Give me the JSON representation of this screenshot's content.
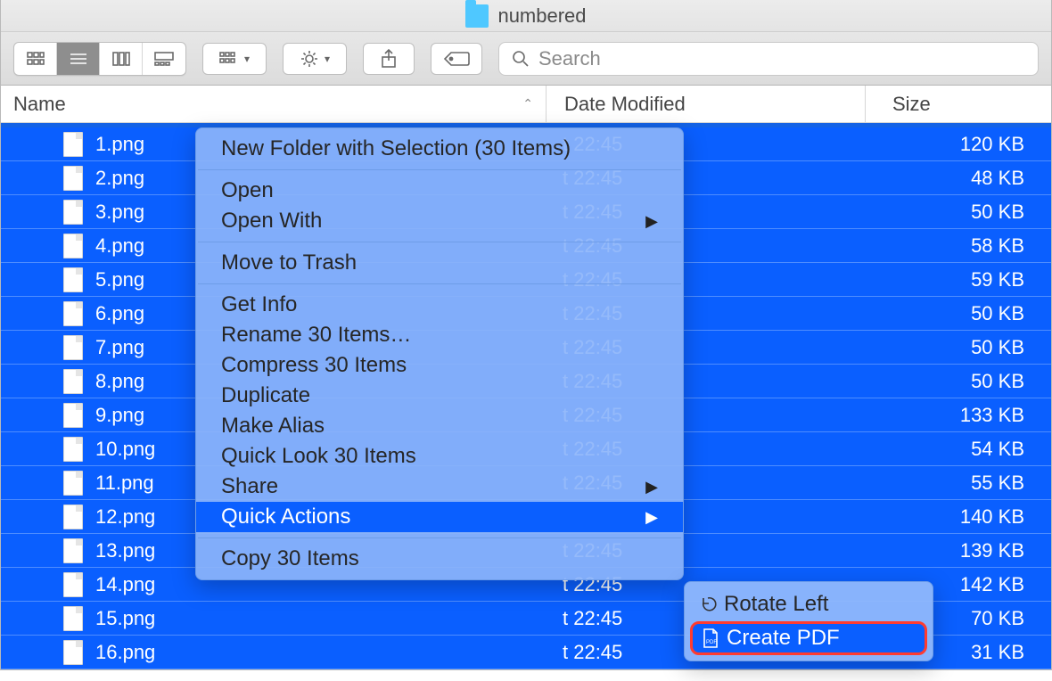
{
  "title": "numbered",
  "search_placeholder": "Search",
  "columns": {
    "name": "Name",
    "date": "Date Modified",
    "size": "Size"
  },
  "rows": [
    {
      "name": "1.png",
      "date": "t 22:45",
      "size": "120 KB"
    },
    {
      "name": "2.png",
      "date": "t 22:45",
      "size": "48 KB"
    },
    {
      "name": "3.png",
      "date": "t 22:45",
      "size": "50 KB"
    },
    {
      "name": "4.png",
      "date": "t 22:45",
      "size": "58 KB"
    },
    {
      "name": "5.png",
      "date": "t 22:45",
      "size": "59 KB"
    },
    {
      "name": "6.png",
      "date": "t 22:45",
      "size": "50 KB"
    },
    {
      "name": "7.png",
      "date": "t 22:45",
      "size": "50 KB"
    },
    {
      "name": "8.png",
      "date": "t 22:45",
      "size": "50 KB"
    },
    {
      "name": "9.png",
      "date": "t 22:45",
      "size": "133 KB"
    },
    {
      "name": "10.png",
      "date": "t 22:45",
      "size": "54 KB"
    },
    {
      "name": "11.png",
      "date": "t 22:45",
      "size": "55 KB"
    },
    {
      "name": "12.png",
      "date": "t 22:45",
      "size": "140 KB"
    },
    {
      "name": "13.png",
      "date": "t 22:45",
      "size": "139 KB"
    },
    {
      "name": "14.png",
      "date": "t 22:45",
      "size": "142 KB"
    },
    {
      "name": "15.png",
      "date": "t 22:45",
      "size": "70 KB"
    },
    {
      "name": "16.png",
      "date": "t 22:45",
      "size": "31 KB"
    }
  ],
  "context_menu": {
    "new_folder": "New Folder with Selection (30 Items)",
    "open": "Open",
    "open_with": "Open With",
    "move_trash": "Move to Trash",
    "get_info": "Get Info",
    "rename": "Rename 30 Items…",
    "compress": "Compress 30 Items",
    "duplicate": "Duplicate",
    "make_alias": "Make Alias",
    "quick_look": "Quick Look 30 Items",
    "share": "Share",
    "quick_actions": "Quick Actions",
    "copy": "Copy 30 Items"
  },
  "submenu": {
    "rotate_left": "Rotate Left",
    "create_pdf": "Create PDF"
  }
}
